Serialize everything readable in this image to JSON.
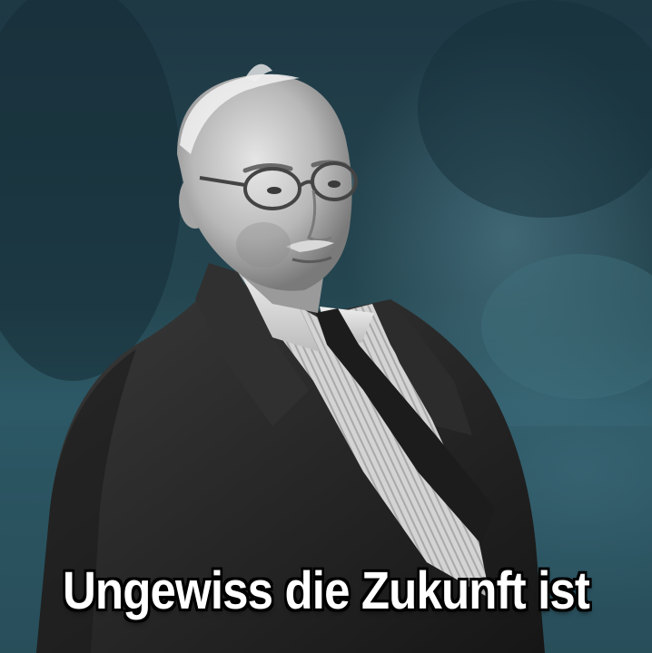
{
  "caption": {
    "text": "Ungewiss die Zukunft ist"
  },
  "colors": {
    "background_teal": "#244650",
    "suit": "#2a2a2a",
    "shirt": "#d8d8d8",
    "caption_text": "#ffffff",
    "caption_outline": "#000000"
  }
}
